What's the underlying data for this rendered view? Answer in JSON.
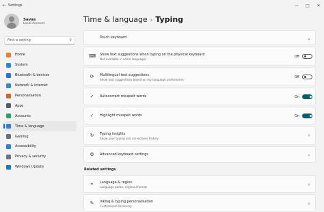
{
  "window": {
    "title": "Settings",
    "back_icon": "back-arrow-icon"
  },
  "profile": {
    "name": "Savas",
    "account": "Local Account"
  },
  "search": {
    "placeholder": "Find a setting"
  },
  "nav": [
    {
      "label": "Home",
      "icon": "home-icon",
      "color": "#e87d2a"
    },
    {
      "label": "System",
      "icon": "system-icon",
      "color": "#2b88d8"
    },
    {
      "label": "Bluetooth & devices",
      "icon": "bluetooth-icon",
      "color": "#2f6ed6"
    },
    {
      "label": "Network & internet",
      "icon": "network-icon",
      "color": "#3a86c8"
    },
    {
      "label": "Personalisation",
      "icon": "brush-icon",
      "color": "#c06b2e"
    },
    {
      "label": "Apps",
      "icon": "apps-icon",
      "color": "#555b66"
    },
    {
      "label": "Accounts",
      "icon": "accounts-icon",
      "color": "#2e9e6a"
    },
    {
      "label": "Time & language",
      "icon": "time-language-icon",
      "color": "#3b7bd1"
    },
    {
      "label": "Gaming",
      "icon": "gaming-icon",
      "color": "#6a6f78"
    },
    {
      "label": "Accessibility",
      "icon": "accessibility-icon",
      "color": "#2b7fd6"
    },
    {
      "label": "Privacy & security",
      "icon": "shield-icon",
      "color": "#6b7380"
    },
    {
      "label": "Windows Update",
      "icon": "update-icon",
      "color": "#1f73d1"
    }
  ],
  "active_nav": "Time & language",
  "header": {
    "parent": "Time & language",
    "separator": "›",
    "current": "Typing"
  },
  "cards": {
    "touch_keyboard": {
      "title": "Touch keyboard",
      "icon": "chevron-down-icon"
    },
    "text_suggestions": {
      "title": "Show text suggestions when typing on the physical keyboard",
      "sub": "Not available in some languages",
      "state": "Off"
    },
    "multilingual": {
      "title": "Multilingual text suggestions",
      "sub": "Show text suggestions based on my language preferences",
      "state": "Off"
    },
    "autocorrect": {
      "title": "Autocorrect misspelt words",
      "state": "On"
    },
    "highlight": {
      "title": "Highlight misspelt words",
      "state": "On"
    },
    "insights": {
      "title": "Typing insights",
      "sub": "Show your typing and corrections history"
    },
    "advanced": {
      "title": "Advanced keyboard settings"
    },
    "related_heading": "Related settings",
    "language_region": {
      "title": "Language & region",
      "sub": "Language packs, regional format"
    },
    "inking": {
      "title": "Inking & typing personalisation",
      "sub": "Customised dictionary"
    }
  },
  "colors": {
    "accent": "#0067c0",
    "toggle_on": "#0f5c69"
  }
}
